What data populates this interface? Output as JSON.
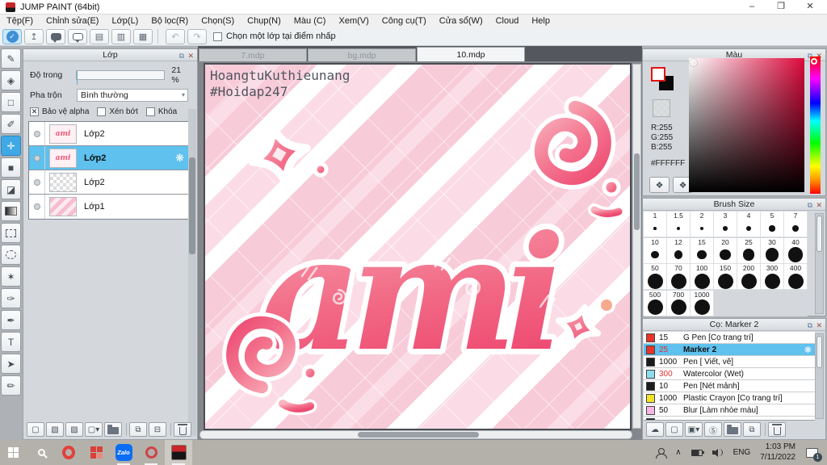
{
  "window": {
    "title": "JUMP PAINT (64bit)",
    "minimize": "–",
    "maximize": "❐",
    "close": "✕"
  },
  "menu": {
    "items": [
      "Tệp(F)",
      "Chỉnh sửa(E)",
      "Lớp(L)",
      "Bộ lọc(R)",
      "Chọn(S)",
      "Chụp(N)",
      "Màu (C)",
      "Xem(V)",
      "Công cụ(T)",
      "Cửa sổ(W)",
      "Cloud",
      "Help"
    ]
  },
  "toolbar": {
    "icons": [
      "medibang-cloud",
      "share",
      "comment",
      "comment-lines",
      "document",
      "document-settings",
      "palette-grid"
    ],
    "undo": "undo",
    "redo": "redo",
    "pick_layer_label": "Chọn một lớp tại điểm nhấp",
    "pick_layer_checked": false
  },
  "tools": [
    {
      "name": "brush"
    },
    {
      "name": "eraser"
    },
    {
      "name": "shape"
    },
    {
      "name": "dot-pen"
    },
    {
      "name": "move",
      "selected": true
    },
    {
      "name": "fill-rect"
    },
    {
      "name": "bucket"
    },
    {
      "name": "gradient"
    },
    {
      "name": "select-rect"
    },
    {
      "name": "select-lasso"
    },
    {
      "name": "magic-wand"
    },
    {
      "name": "select-pen"
    },
    {
      "name": "select-eraser"
    },
    {
      "name": "text"
    },
    {
      "name": "operation"
    },
    {
      "name": "div-tool"
    }
  ],
  "layers_panel": {
    "title": "Lớp",
    "opacity_label": "Độ trong",
    "opacity_value": "21 %",
    "opacity_percent": 21,
    "blend_label": "Pha trộn",
    "blend_value": "Bình thường",
    "checkboxes": [
      {
        "label": "Bảo vệ alpha",
        "checked": true
      },
      {
        "label": "Xén bớt",
        "checked": false
      },
      {
        "label": "Khóa",
        "checked": false
      }
    ],
    "layers": [
      {
        "name": "Lớp2",
        "thumb": "art"
      },
      {
        "name": "Lớp2",
        "thumb": "art",
        "selected": true
      },
      {
        "name": "Lớp2",
        "thumb": "checker"
      },
      {
        "name": "Lớp1",
        "thumb": "stripes"
      }
    ],
    "thumb_word": "ami",
    "bottom_icons": [
      "new-layer",
      "new-8bit-layer",
      "new-1bit-layer",
      "add-layer-menu",
      "new-folder",
      "duplicate-layer",
      "merge-layer",
      "delete-layer"
    ]
  },
  "canvas": {
    "tabs": [
      {
        "label": "7.mdp"
      },
      {
        "label": "bg.mdp"
      },
      {
        "label": "10.mdp",
        "active": true
      }
    ],
    "watermark_line1": "HoangtuKuthieunang",
    "watermark_line2": "#Hoidap247",
    "artwork_word": "ami",
    "art_colors": {
      "light": "#f9b6c1",
      "mid": "#f3718c",
      "deep": "#ee4a71"
    }
  },
  "color_panel": {
    "title": "Màu",
    "r": "R:255",
    "g": "G:255",
    "b": "B:255",
    "hex": "#FFFFFF",
    "palette_icons": [
      "palette",
      "palette-edit"
    ]
  },
  "brush_size_panel": {
    "title": "Brush Size",
    "sizes": [
      "1",
      "1.5",
      "2",
      "3",
      "4",
      "5",
      "7",
      "10",
      "12",
      "15",
      "20",
      "25",
      "30",
      "40",
      "50",
      "70",
      "100",
      "150",
      "200",
      "300",
      "400",
      "500",
      "700",
      "1000"
    ]
  },
  "brush_panel": {
    "title": "Cọ: Marker 2",
    "brushes": [
      {
        "size": "15",
        "name": "G Pen [Cọ trang trí]",
        "swatch": "#e8342c"
      },
      {
        "size": "25",
        "name": "Marker 2",
        "swatch": "#e8342c",
        "red_num": true,
        "selected": true
      },
      {
        "size": "1000",
        "name": "Pen [ Viết, vẽ]",
        "swatch": "#1c1c1c"
      },
      {
        "size": "300",
        "name": "Watercolor (Wet)",
        "swatch": "#8edbee",
        "red_num": true
      },
      {
        "size": "10",
        "name": "Pen [Nét mảnh]",
        "swatch": "#1c1c1c"
      },
      {
        "size": "1000",
        "name": "Plastic Crayon [Cọ trang trí]",
        "swatch": "#f2e22a"
      },
      {
        "size": "50",
        "name": "Blur [Làm nhòe màu]",
        "swatch": "#f6b6e6"
      },
      {
        "size": "",
        "name": "",
        "swatch": "#202020",
        "partial": true
      }
    ],
    "bottom_icons": [
      "cloud-brush",
      "new-brush",
      "save-brush-menu",
      "script-brush",
      "brush-folder",
      "duplicate-brush",
      "delete-brush"
    ]
  },
  "taskbar": {
    "apps": [
      {
        "name": "start"
      },
      {
        "name": "search"
      },
      {
        "name": "opera"
      },
      {
        "name": "tiles"
      },
      {
        "name": "zalo",
        "running": true
      },
      {
        "name": "opera-gx",
        "running": true
      },
      {
        "name": "jump-paint",
        "running": true,
        "active": true
      }
    ],
    "zalo_label": "Zalo",
    "language": "ENG",
    "time": "1:03 PM",
    "date": "7/11/2022",
    "notification_count": "1"
  }
}
